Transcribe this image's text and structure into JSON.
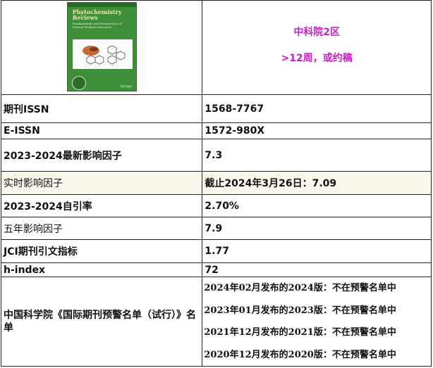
{
  "header": {
    "cover": {
      "title": "Phytochemistry Reviews",
      "subtitle": "Fundamentals and Perspectives of Natural Products Research",
      "publisher": "Springer"
    },
    "zone": "中科院2区",
    "review_time": ">12周，或约稿"
  },
  "rows": [
    {
      "label": "期刊ISSN",
      "value": "1568-7767"
    },
    {
      "label": "E-ISSN",
      "value": "1572-980X"
    },
    {
      "label": "2023-2024最新影响因子",
      "value": "7.3"
    },
    {
      "label": "实时影响因子",
      "value": "截止2024年3月26日：7.09"
    },
    {
      "label": "2023-2024自引率",
      "value": "2.70%"
    },
    {
      "label": "五年影响因子",
      "value": "7.9"
    },
    {
      "label": "JCI期刊引文指标",
      "value": "1.77"
    },
    {
      "label": "h-index",
      "value": "72"
    }
  ],
  "warning": {
    "label": "中国科学院《国际期刊预警名单（试行）》名单",
    "entries": [
      "2024年02月发布的2024版：不在预警名单中",
      "2023年01月发布的2023版：不在预警名单中",
      "2021年12月发布的2021版：不在预警名单中",
      "2020年12月发布的2020版：不在预警名单中"
    ]
  }
}
